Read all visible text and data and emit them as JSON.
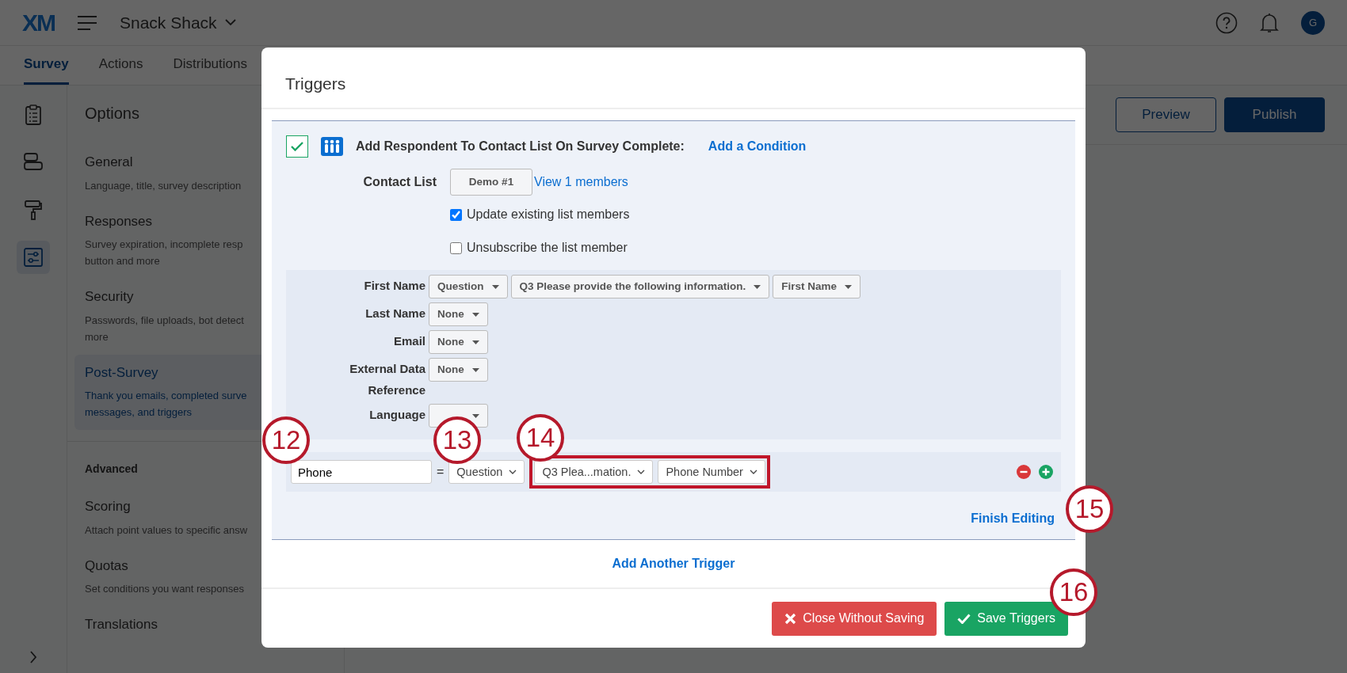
{
  "header": {
    "logo": "XM",
    "project": "Snack Shack",
    "avatar": "G"
  },
  "tabs": [
    {
      "label": "Survey",
      "selected": true
    },
    {
      "label": "Actions",
      "selected": false
    },
    {
      "label": "Distributions",
      "selected": false
    }
  ],
  "rail": [
    {
      "kind": "clipboard",
      "selected": false
    },
    {
      "kind": "blocks",
      "selected": false
    },
    {
      "kind": "roller",
      "selected": false
    },
    {
      "kind": "sliders",
      "selected": true
    }
  ],
  "options": {
    "title": "Options",
    "items": [
      {
        "title": "General",
        "description_lines": [
          "Language, title, survey description"
        ],
        "selected": false
      },
      {
        "title": "Responses",
        "description_lines": [
          "Survey expiration, incomplete resp",
          "button and more"
        ],
        "selected": false
      },
      {
        "title": "Security",
        "description_lines": [
          "Passwords, file uploads, bot detect",
          "more"
        ],
        "selected": false
      },
      {
        "title": "Post-Survey",
        "description_lines": [
          "Thank you emails, completed surve",
          "messages, and triggers"
        ],
        "selected": true
      }
    ],
    "section": "Advanced",
    "advanced_items": [
      {
        "title": "Scoring",
        "description_lines": [
          "Attach point values to specific answ"
        ]
      },
      {
        "title": "Quotas",
        "description_lines": [
          "Set conditions you want responses"
        ]
      },
      {
        "title": "Translations"
      }
    ]
  },
  "toolbar": [
    {
      "label": "Preview",
      "kind": "outline"
    },
    {
      "label": "Publish",
      "kind": "primary"
    }
  ],
  "modal": {
    "title": "Triggers",
    "trigger": {
      "checked": true,
      "title": "Add Respondent To Contact List On Survey Complete:",
      "condition_link": "Add a Condition",
      "contact_list": {
        "label": "Contact List",
        "value": "Demo #1",
        "link": "View 1 members"
      },
      "checkboxes": [
        {
          "label": "Update existing list members",
          "checked": true
        },
        {
          "label": "Unsubscribe the list member",
          "checked": false
        }
      ],
      "mappings": [
        {
          "label": "First Name",
          "selects": [
            "Question",
            "Q3 Please provide the following information.",
            "First Name"
          ]
        },
        {
          "label": "Last Name",
          "selects": [
            "None"
          ]
        },
        {
          "label": "Email",
          "selects": [
            "None"
          ]
        },
        {
          "label": "External Data Reference",
          "selects": [
            "None"
          ]
        },
        {
          "label": "Language",
          "select_obscured": true
        }
      ],
      "custom_field": {
        "name": "Phone",
        "operator": "=",
        "selects": [
          {
            "text": "Question",
            "highlighted": false
          },
          {
            "text": "Q3 Plea...mation.",
            "highlighted": true
          },
          {
            "text": "Phone Number",
            "highlighted": true
          }
        ]
      },
      "finish_link": "Finish Editing"
    },
    "add_trigger": "Add Another Trigger",
    "buttons": [
      {
        "label": "Close Without Saving",
        "kind": "danger"
      },
      {
        "label": "Save Triggers",
        "kind": "success"
      }
    ]
  },
  "callouts": [
    {
      "number": "12"
    },
    {
      "number": "13"
    },
    {
      "number": "14"
    },
    {
      "number": "15"
    },
    {
      "number": "16"
    }
  ]
}
